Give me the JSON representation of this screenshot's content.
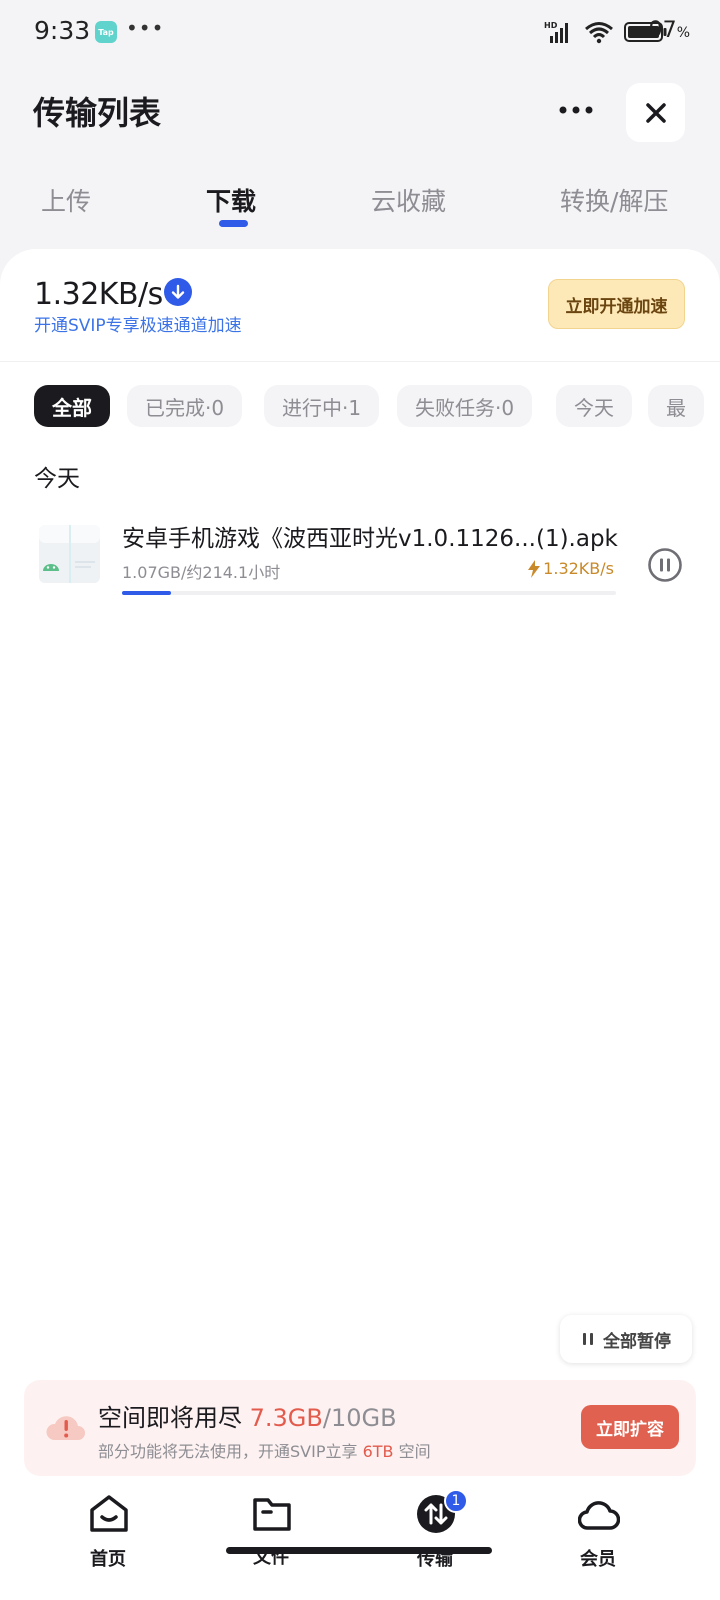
{
  "status_bar": {
    "time": "9:33",
    "app_badge": "Tap",
    "dots": "•••",
    "network": "HD",
    "battery_percent": "97",
    "battery_unit": "%"
  },
  "header": {
    "title": "传输列表"
  },
  "tabs": [
    {
      "label": "上传",
      "active": false
    },
    {
      "label": "下载",
      "active": true
    },
    {
      "label": "云收藏",
      "active": false
    },
    {
      "label": "转换/解压",
      "active": false
    }
  ],
  "speed": {
    "value": "1.32KB/s",
    "promo": "开通SVIP专享极速通道加速",
    "boost_button": "立即开通加速"
  },
  "filters": [
    {
      "label": "全部",
      "active": true
    },
    {
      "label": "已完成·0",
      "active": false
    },
    {
      "label": "进行中·1",
      "active": false
    },
    {
      "label": "失败任务·0",
      "active": false
    },
    {
      "label": "今天",
      "active": false
    },
    {
      "label": "最",
      "active": false
    }
  ],
  "section_label": "今天",
  "downloads": [
    {
      "name": "安卓手机游戏《波西亚时光v1.0.1126...(1).apk",
      "meta": "1.07GB/约214.1小时",
      "speed": "1.32KB/s",
      "progress": 0.1,
      "icon": "android-apk-icon"
    }
  ],
  "pause_all": {
    "label": "全部暂停"
  },
  "storage_banner": {
    "title": "空间即将用尽",
    "used": "7.3GB",
    "total": "/10GB",
    "sub_prefix": "部分功能将无法使用，开通SVIP立享",
    "sub_highlight": "6TB",
    "sub_suffix": "空间",
    "button": "立即扩容"
  },
  "bottom_nav": [
    {
      "label": "首页",
      "icon": "home-icon"
    },
    {
      "label": "文件",
      "icon": "folder-icon"
    },
    {
      "label": "传输",
      "icon": "transfer-icon",
      "badge": "1"
    },
    {
      "label": "会员",
      "icon": "cloud-icon"
    }
  ],
  "colors": {
    "accent": "#2f5be8",
    "warning": "#e35b4c",
    "gold": "#c98a2a"
  }
}
